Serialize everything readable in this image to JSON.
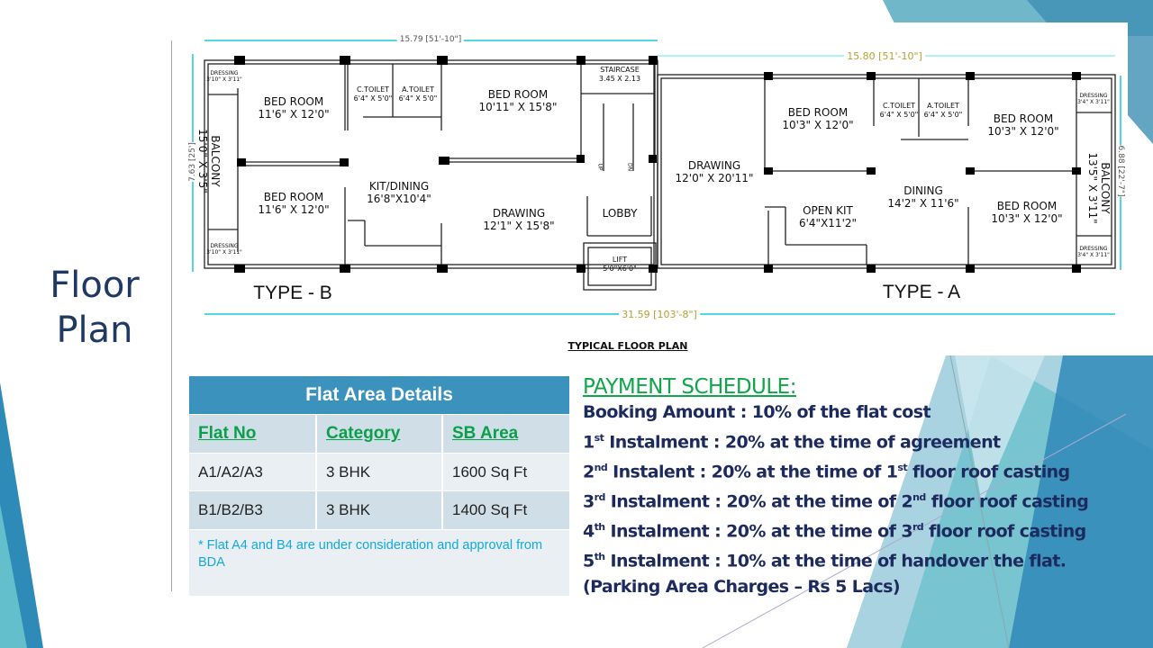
{
  "slide": {
    "title_line1": "Floor",
    "title_line2": "Plan"
  },
  "plan": {
    "caption": "TYPICAL FLOOR PLAN",
    "type_b": "TYPE - B",
    "type_a": "TYPE - A",
    "dim_top_b": "15.79 [51'-10\"]",
    "dim_top_a": "15.80 [51'-10\"]",
    "dim_total": "31.59 [103'-8\"]",
    "dim_left": "7.63 [25']",
    "dim_right": "6.88 [22'-7\"]",
    "rooms_b": [
      {
        "name": "BED ROOM",
        "size": "11'6\" X 12'0\""
      },
      {
        "name": "BED ROOM",
        "size": "11'6\" X 12'0\""
      },
      {
        "name": "C.TOILET",
        "size": "6'4\" X 5'0\""
      },
      {
        "name": "A.TOILET",
        "size": "6'4\" X 5'0\""
      },
      {
        "name": "BED ROOM",
        "size": "10'11\" X 15'8\""
      },
      {
        "name": "KIT/DINING",
        "size": "16'8\"X10'4\""
      },
      {
        "name": "DRAWING",
        "size": "12'1\" X 15'8\""
      },
      {
        "name": "DRESSING",
        "size": "3'10\" X 3'11\""
      },
      {
        "name": "DRESSING",
        "size": "3'10\" X 3'11\""
      },
      {
        "name": "BALCONY",
        "size": "15'0\" X 3'5\""
      }
    ],
    "core": [
      {
        "name": "STAIRCASE",
        "size": "3.45 X 2.13"
      },
      {
        "name": "LOBBY",
        "size": ""
      },
      {
        "name": "LIFT",
        "size": "5'0\"X6'0\""
      },
      {
        "up": "UP",
        "dn": "DN"
      }
    ],
    "rooms_a": [
      {
        "name": "DRAWING",
        "size": "12'0\" X 20'11\""
      },
      {
        "name": "BED ROOM",
        "size": "10'3\" X 12'0\""
      },
      {
        "name": "C.TOILET",
        "size": "6'4\" X 5'0\""
      },
      {
        "name": "A.TOILET",
        "size": "6'4\" X 5'0\""
      },
      {
        "name": "BED ROOM",
        "size": "10'3\" X 12'0\""
      },
      {
        "name": "OPEN KIT",
        "size": "6'4\"X11'2\""
      },
      {
        "name": "DINING",
        "size": "14'2\" X 11'6\""
      },
      {
        "name": "BED ROOM",
        "size": "10'3\" X 12'0\""
      },
      {
        "name": "DRESSING",
        "size": "3'4\" X 3'11\""
      },
      {
        "name": "DRESSING",
        "size": "3'4\" X 3'11\""
      },
      {
        "name": "BALCONY",
        "size": "13'5\" X 3'11\""
      }
    ]
  },
  "table": {
    "title": "Flat Area Details",
    "columns": [
      "Flat No",
      "Category",
      "SB Area"
    ],
    "rows": [
      [
        "A1/A2/A3",
        "3 BHK",
        "1600 Sq Ft"
      ],
      [
        "B1/B2/B3",
        "3 BHK",
        "1400 Sq Ft"
      ]
    ],
    "note": "* Flat A4 and B4 are under consideration and approval from BDA"
  },
  "payment": {
    "title": "PAYMENT SCHEDULE:",
    "lines": [
      {
        "n": "",
        "s": "",
        "t": "Booking Amount : 10% of the flat cost"
      },
      {
        "n": "1",
        "s": "st",
        "t": " Instalment : 20% at the time of agreement"
      },
      {
        "n": "2",
        "s": "nd",
        "t": " Instalent : 20% at the time of 1",
        "s2": "st",
        "t2": " floor roof casting"
      },
      {
        "n": "3",
        "s": "rd",
        "t": " Instalment : 20% at the time of 2",
        "s2": "nd",
        "t2": " floor roof casting"
      },
      {
        "n": "4",
        "s": "th",
        "t": " Instalment : 20% at the time of 3",
        "s2": "rd",
        "t2": " floor roof casting"
      },
      {
        "n": "5",
        "s": "th",
        "t": " Instalment : 10% at the time of handover the flat."
      },
      {
        "n": "",
        "s": "",
        "t": "(Parking Area Charges – Rs 5 Lacs)"
      }
    ]
  },
  "colors": {
    "title": "#1f3864",
    "table_header": "#3b93bd",
    "green": "#10a64a",
    "navy": "#1c2a5e",
    "note": "#13a9e0"
  }
}
